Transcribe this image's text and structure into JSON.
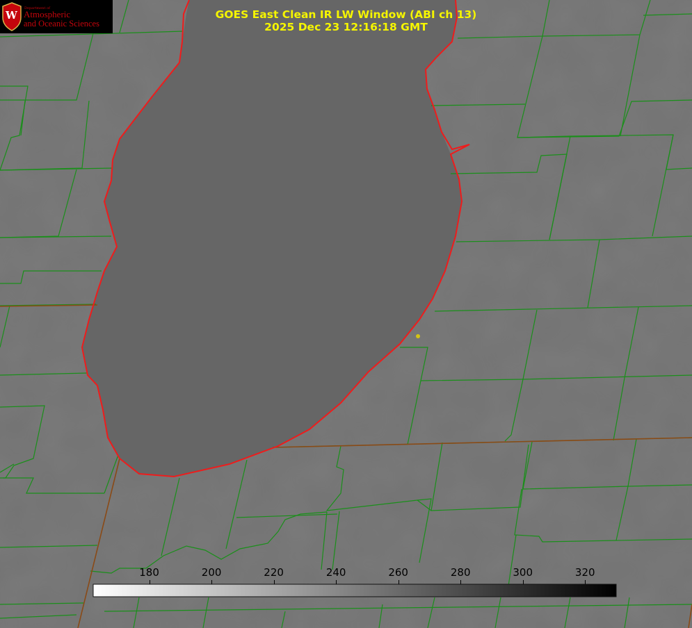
{
  "title": {
    "line1": "GOES East Clean IR LW Window (ABI ch 13)",
    "line2": "2025 Dec 23 12:16:18 GMT"
  },
  "logo": {
    "department": "Department of",
    "line1": "Atmospheric",
    "line2": "and Oceanic Sciences",
    "seal_letter": "W",
    "icon": "uw-crest-icon"
  },
  "colorbar": {
    "ticks": [
      "180",
      "200",
      "220",
      "240",
      "260",
      "280",
      "300",
      "320"
    ],
    "range": [
      162,
      330
    ],
    "colormap": "white-to-black"
  },
  "colors": {
    "title": "#f5f500",
    "county_lines": "#1a8f1a",
    "shoreline": "#ee1c1c",
    "state_border": "#8a4a16",
    "marker": "#d4c314",
    "lake": "#656565",
    "land": "#777777"
  }
}
